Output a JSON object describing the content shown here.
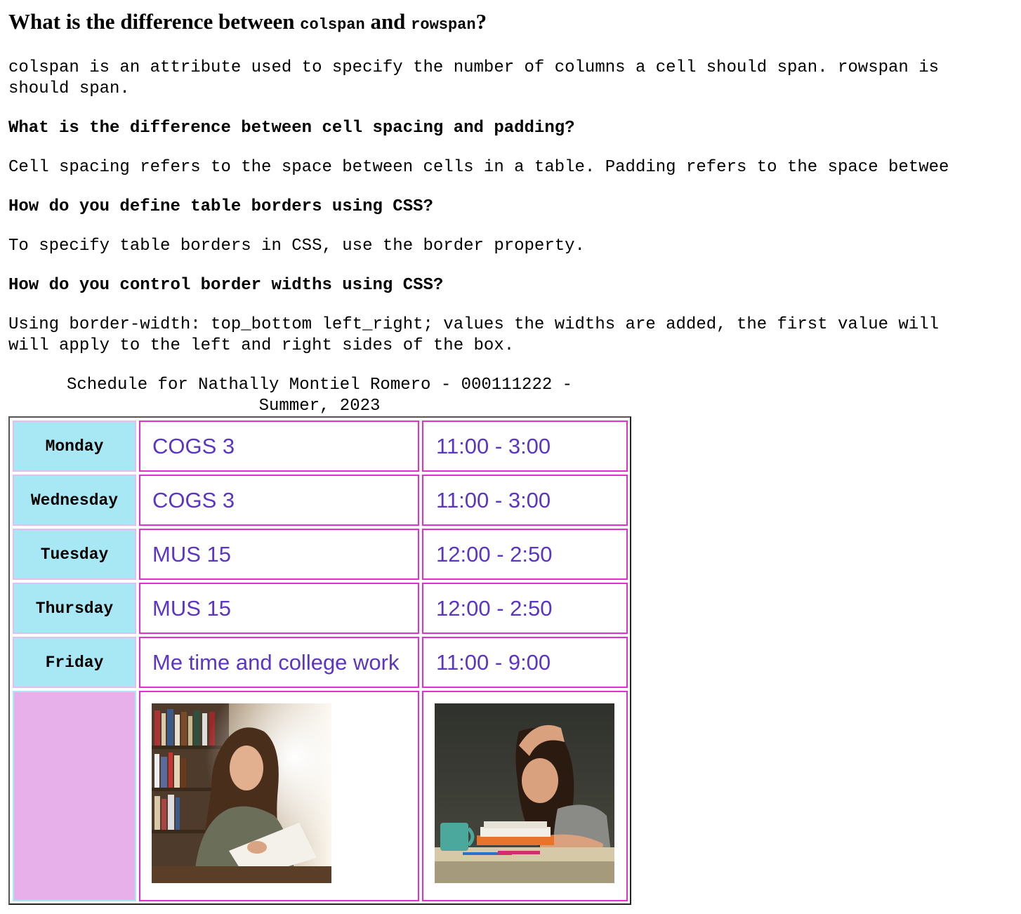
{
  "faq": {
    "heading_prefix": "What is the difference between ",
    "heading_code1": "colspan",
    "heading_and": " and ",
    "heading_code2": "rowspan",
    "heading_suffix": "?",
    "answer1": "colspan is an attribute used to specify the number of columns a cell should span. rowspan is",
    "answer1_cont": "should span.",
    "q2": "What is the difference between cell spacing and padding?",
    "answer2": "Cell spacing refers to the space between cells in a table. Padding refers to the space betwee",
    "q3": "How do you define table borders using CSS?",
    "answer3": "To specify table borders in CSS, use the border property.",
    "q4": "How do you control border widths using CSS?",
    "answer4": "Using border-width: top_bottom left_right; values the widths are added, the first value will",
    "answer4_cont": "will apply to the left and right sides of the box."
  },
  "schedule": {
    "caption_line1": "Schedule for Nathally Montiel Romero - 000111222 -",
    "caption_line2": "Summer, 2023",
    "rows": [
      {
        "day": "Monday",
        "course": "COGS 3",
        "time": "11:00 - 3:00"
      },
      {
        "day": "Wednesday",
        "course": "COGS 3",
        "time": "11:00 - 3:00"
      },
      {
        "day": "Tuesday",
        "course": "MUS 15",
        "time": "12:00 - 2:50"
      },
      {
        "day": "Thursday",
        "course": "MUS 15",
        "time": "12:00 - 2:50"
      },
      {
        "day": "Friday",
        "course": "Me time and college work",
        "time": "11:00 - 9:00"
      }
    ]
  },
  "colors": {
    "day_cell_bg": "#a8e8f4",
    "empty_cell_bg": "#e8b0ea",
    "cell_border": "#e030d0",
    "course_text": "#5b36c4"
  }
}
